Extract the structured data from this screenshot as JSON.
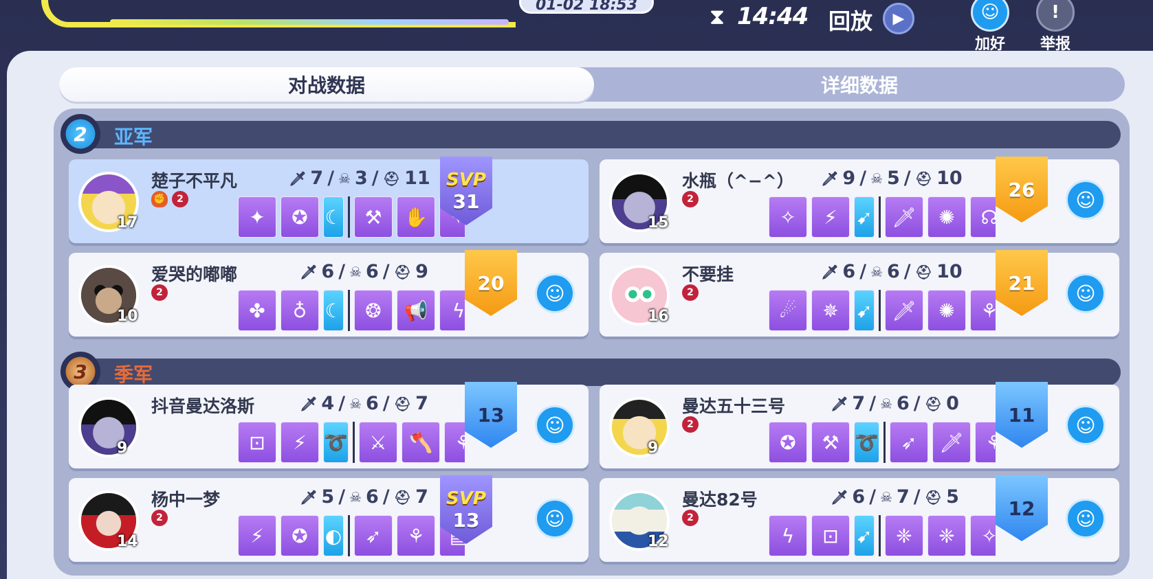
{
  "header": {
    "datetime": "01-02  18:53",
    "timer": "14:44",
    "replay_label": "回放",
    "add_friend_label": "加好友",
    "report_label": "举报"
  },
  "tabs": [
    {
      "label": "对战数据",
      "active": true
    },
    {
      "label": "详细数据",
      "active": false
    }
  ],
  "sections": [
    {
      "rank": "2",
      "title": "亚军"
    },
    {
      "rank": "3",
      "title": "季军"
    }
  ],
  "players": [
    {
      "name": "楚子不平凡",
      "level": "17",
      "kills": "7",
      "deaths": "3",
      "assists": "11",
      "score": "31",
      "svp": true,
      "svp_label": "SVP",
      "highlight": true
    },
    {
      "name": "水瓶（^−^）",
      "level": "15",
      "kills": "9",
      "deaths": "5",
      "assists": "10",
      "score": "26",
      "svp": false
    },
    {
      "name": "爱哭的嘟嘟",
      "level": "10",
      "kills": "6",
      "deaths": "6",
      "assists": "9",
      "score": "20",
      "svp": false
    },
    {
      "name": "不要挂",
      "level": "16",
      "kills": "6",
      "deaths": "6",
      "assists": "10",
      "score": "21",
      "svp": false
    },
    {
      "name": "抖音曼达洛斯",
      "level": "9",
      "kills": "4",
      "deaths": "6",
      "assists": "7",
      "score": "13",
      "svp": false
    },
    {
      "name": "曼达五十三号",
      "level": "9",
      "kills": "7",
      "deaths": "6",
      "assists": "0",
      "score": "11",
      "svp": false
    },
    {
      "name": "杨中一梦",
      "level": "14",
      "kills": "5",
      "deaths": "6",
      "assists": "7",
      "score": "13",
      "svp": true,
      "svp_label": "SVP"
    },
    {
      "name": "曼达82号",
      "level": "12",
      "kills": "6",
      "deaths": "7",
      "assists": "5",
      "score": "12",
      "svp": false
    }
  ],
  "colors": {
    "gold_flag": "#f59a12",
    "blue_flag": "#2f86ef",
    "svp_flag": "#6f5bd9",
    "skill_purple": "#8d4fe0",
    "skill_blue": "#1da2e8",
    "section_bar": "#424a6f"
  },
  "icons": {
    "kills": "sword-icon",
    "deaths": "skull-icon",
    "assists": "helmet-icon",
    "add_friend": "add-friend-icon",
    "report": "warning-icon",
    "replay": "play-icon",
    "timer": "hourglass-icon"
  }
}
